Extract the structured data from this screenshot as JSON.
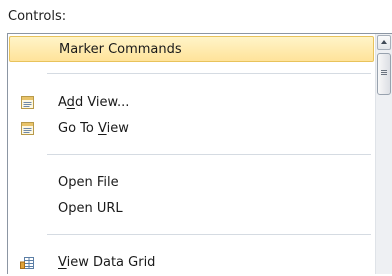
{
  "header": {
    "label": "Controls:"
  },
  "items": [
    {
      "label": "Marker Commands",
      "highlighted": true
    },
    {
      "pre": "A",
      "mn": "d",
      "post": "d View...",
      "icon": "add-view-icon"
    },
    {
      "pre": "Go To ",
      "mn": "V",
      "post": "iew",
      "icon": "go-to-view-icon"
    },
    {
      "label": "Open File"
    },
    {
      "label": "Open URL"
    },
    {
      "pre": "",
      "mn": "V",
      "post": "iew Data Grid",
      "icon": "data-grid-icon"
    }
  ],
  "colors": {
    "highlight": "#ffe39a",
    "highlight_border": "#e8c35c",
    "border": "#8c96a3"
  }
}
